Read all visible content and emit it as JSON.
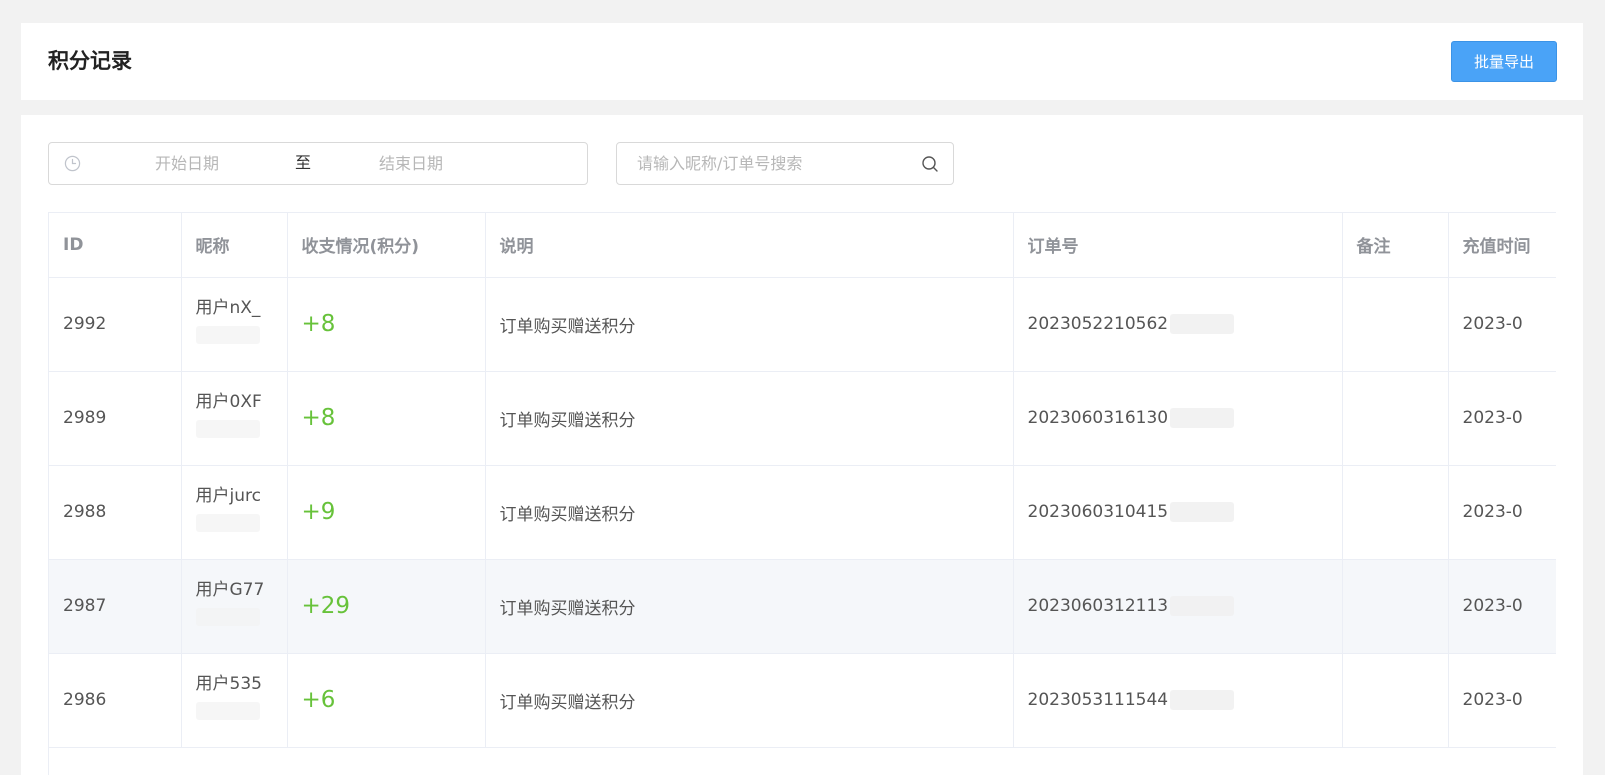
{
  "header": {
    "title": "积分记录",
    "export_label": "批量导出"
  },
  "filters": {
    "start_placeholder": "开始日期",
    "range_separator": "至",
    "end_placeholder": "结束日期",
    "search_placeholder": "请输入昵称/订单号搜索"
  },
  "table": {
    "columns": [
      "ID",
      "昵称",
      "收支情况(积分)",
      "说明",
      "订单号",
      "备注",
      "充值时间"
    ],
    "rows": [
      {
        "id": "2992",
        "nickname": "用户nX_",
        "points": "+8",
        "desc": "订单购买赠送积分",
        "order_no": "2023052210562",
        "remark": "",
        "time": "2023-0"
      },
      {
        "id": "2989",
        "nickname": "用户0XF",
        "points": "+8",
        "desc": "订单购买赠送积分",
        "order_no": "2023060316130",
        "remark": "",
        "time": "2023-0"
      },
      {
        "id": "2988",
        "nickname": "用户jurc",
        "points": "+9",
        "desc": "订单购买赠送积分",
        "order_no": "2023060310415",
        "remark": "",
        "time": "2023-0"
      },
      {
        "id": "2987",
        "nickname": "用户G77",
        "points": "+29",
        "desc": "订单购买赠送积分",
        "order_no": "2023060312113",
        "remark": "",
        "time": "2023-0"
      },
      {
        "id": "2986",
        "nickname": "用户535",
        "points": "+6",
        "desc": "订单购买赠送积分",
        "order_no": "2023053111544",
        "remark": "",
        "time": "2023-0"
      }
    ]
  },
  "colors": {
    "primary": "#4aa3f7",
    "positive_points": "#67c23a",
    "header_text": "#909399",
    "hover_row": "#f5f7fa"
  },
  "icons": {
    "date": "clock-icon",
    "search": "search-icon"
  }
}
